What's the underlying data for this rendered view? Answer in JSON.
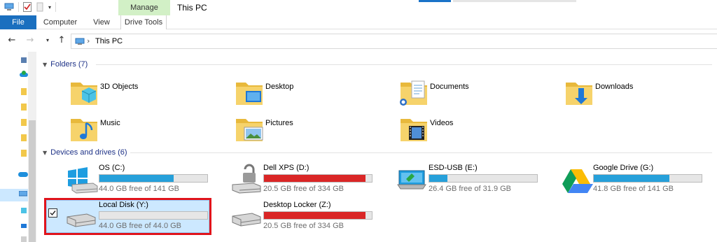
{
  "window": {
    "title": "This PC"
  },
  "ribbon": {
    "context_group": "Manage",
    "tabs": [
      {
        "label": "File"
      },
      {
        "label": "Computer"
      },
      {
        "label": "View"
      },
      {
        "label": "Drive Tools"
      }
    ]
  },
  "address": {
    "crumb": "This PC"
  },
  "folders": {
    "header": "Folders (7)",
    "items": [
      {
        "name": "3D Objects",
        "icon": "3d-objects-folder-icon"
      },
      {
        "name": "Desktop",
        "icon": "desktop-folder-icon"
      },
      {
        "name": "Documents",
        "icon": "documents-folder-icon"
      },
      {
        "name": "Downloads",
        "icon": "downloads-folder-icon"
      },
      {
        "name": "Music",
        "icon": "music-folder-icon"
      },
      {
        "name": "Pictures",
        "icon": "pictures-folder-icon"
      },
      {
        "name": "Videos",
        "icon": "videos-folder-icon"
      }
    ]
  },
  "drives": {
    "header": "Devices and drives (6)",
    "items": [
      {
        "name": "OS (C:)",
        "free": "44.0 GB free of 141 GB",
        "used_fraction": 0.69,
        "color": "#26a0da",
        "icon": "windows-drive-icon"
      },
      {
        "name": "Dell XPS (D:)",
        "free": "20.5 GB free of 334 GB",
        "used_fraction": 0.94,
        "color": "#da2626",
        "icon": "locked-drive-icon"
      },
      {
        "name": "ESD-USB (E:)",
        "free": "26.4 GB free of 31.9 GB",
        "used_fraction": 0.17,
        "color": "#26a0da",
        "icon": "usb-drive-icon"
      },
      {
        "name": "Google Drive (G:)",
        "free": "41.8 GB free of 141 GB",
        "used_fraction": 0.7,
        "color": "#26a0da",
        "icon": "google-drive-icon"
      },
      {
        "name": "Local Disk (Y:)",
        "free": "44.0 GB free of 44.0 GB",
        "used_fraction": 0.0,
        "color": "#26a0da",
        "icon": "hard-drive-icon",
        "selected": true
      },
      {
        "name": "Desktop Locker (Z:)",
        "free": "20.5 GB free of 334 GB",
        "used_fraction": 0.94,
        "color": "#da2626",
        "icon": "hard-drive-icon"
      }
    ]
  }
}
